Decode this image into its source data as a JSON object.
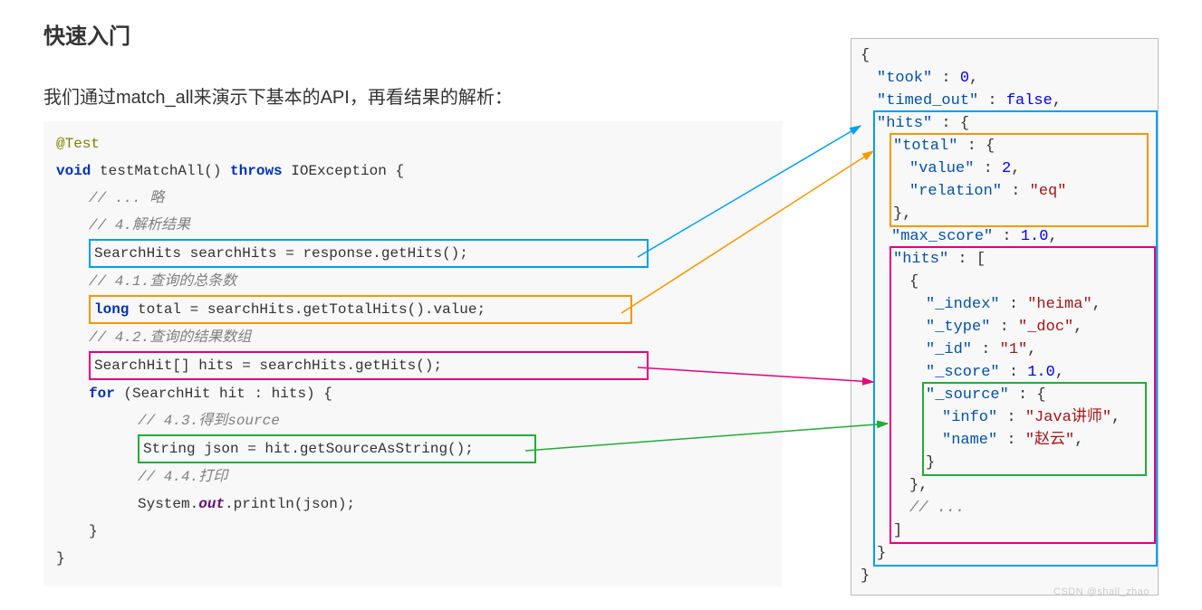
{
  "title": "快速入门",
  "intro": "我们通过match_all来演示下基本的API，再看结果的解析：",
  "watermark": "CSDN @shall_zhao",
  "code": {
    "annot": "@Test",
    "sig_void": "void",
    "sig_name": " testMatchAll() ",
    "sig_throws": "throws",
    "sig_ex": " IOException {",
    "c_ellipsis": "// ... 略",
    "c4": "// 4.解析结果",
    "l_hits": "SearchHits searchHits = response.getHits();",
    "c41": "// 4.1.查询的总条数",
    "l_total_kw": "long",
    "l_total_rest": " total = searchHits.getTotalHits().value;",
    "c42": "// 4.2.查询的结果数组",
    "l_hitsarr": "SearchHit[] hits = searchHits.getHits();",
    "for_kw": "for",
    "for_rest": " (SearchHit hit : hits) {",
    "c43": "// 4.3.得到source",
    "l_json": "String json = hit.getSourceAsString();",
    "c44": "// 4.4.打印",
    "print_pre": "System.",
    "print_out": "out",
    "print_post": ".println(json);",
    "rb1": "}",
    "rb2": "}"
  },
  "json": {
    "lb": "{",
    "took_k": "\"took\"",
    "took_v": "0",
    "timed_k": "\"timed_out\"",
    "timed_v": "false",
    "hits_k": "\"hits\"",
    "total_k": "\"total\"",
    "value_k": "\"value\"",
    "value_v": "2",
    "relation_k": "\"relation\"",
    "relation_v": "\"eq\"",
    "max_k": "\"max_score\"",
    "max_v": "1.0",
    "hits2_k": "\"hits\"",
    "index_k": "\"_index\"",
    "index_v": "\"heima\"",
    "type_k": "\"_type\"",
    "type_v": "\"_doc\"",
    "id_k": "\"_id\"",
    "id_v": "\"1\"",
    "score_k": "\"_score\"",
    "score_v": "1.0",
    "source_k": "\"_source\"",
    "info_k": "\"info\"",
    "info_v": "\"Java讲师\"",
    "name_k": "\"name\"",
    "name_v": "\"赵云\"",
    "ell": "// ...",
    "colon_lb": " : {",
    "colon_sp": " : ",
    "colon_lbr": " : [",
    "rb": "}",
    "rbr": "]",
    "comma": ",",
    "lbrace_only": "{",
    "rb_comma": "},"
  }
}
